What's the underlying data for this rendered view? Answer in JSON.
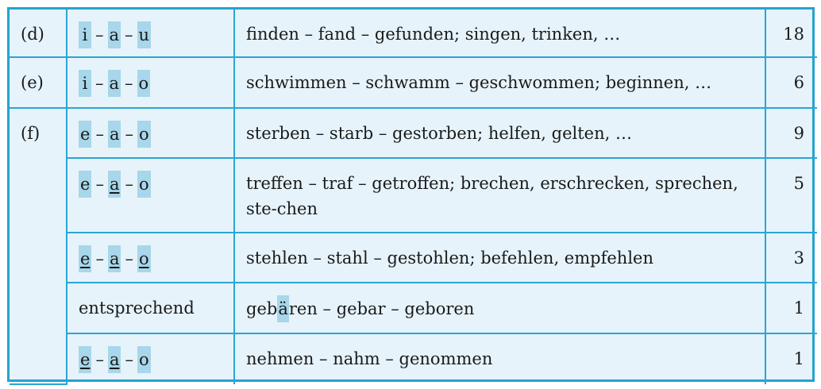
{
  "rows": [
    {
      "letter": "(d)",
      "pattern": [
        "i",
        "a",
        "u"
      ],
      "underline": [
        false,
        false,
        false
      ],
      "examples": "finden – fand – gefunden; singen, trinken, …",
      "count": "18"
    },
    {
      "letter": "(e)",
      "pattern": [
        "i",
        "a",
        "o"
      ],
      "underline": [
        false,
        false,
        false
      ],
      "examples": "schwimmen – schwamm – geschwommen; beginnen, …",
      "count": "6"
    },
    {
      "letter": "(f)",
      "pattern": [
        "e",
        "a",
        "o"
      ],
      "underline": [
        false,
        false,
        false
      ],
      "examples": "sterben – starb – gestorben; helfen, gelten, …",
      "count": "9"
    },
    {
      "letter": "",
      "pattern": [
        "e",
        "a",
        "o"
      ],
      "underline": [
        false,
        true,
        false
      ],
      "examples": "treffen – traf – getroffen; brechen, erschrecken, sprechen, ste-chen",
      "count": "5"
    },
    {
      "letter": "",
      "pattern": [
        "e",
        "a",
        "o"
      ],
      "underline": [
        true,
        true,
        true
      ],
      "examples": "stehlen – stahl – gestohlen; befehlen, empfehlen",
      "count": "3"
    },
    {
      "letter": "",
      "pattern_text": "entsprechend",
      "examples_parts": [
        "geb",
        "ä",
        "ren – gebar – geboren"
      ],
      "count": "1"
    },
    {
      "letter": "",
      "pattern": [
        "e",
        "a",
        "o"
      ],
      "underline": [
        true,
        true,
        false
      ],
      "examples": "nehmen – nahm – genommen",
      "count": "1"
    }
  ],
  "colors": {
    "border": "#24a3d0",
    "background": "#e6f3fa",
    "highlight": "#a8d6ea"
  }
}
